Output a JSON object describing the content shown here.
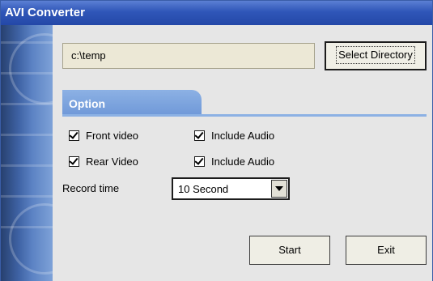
{
  "window": {
    "title": "AVI Converter"
  },
  "directory": {
    "value": "c:\\temp",
    "button_label": "Select Directory"
  },
  "option": {
    "tab_label": "Option",
    "front_video": {
      "label": "Front video",
      "checked": true
    },
    "front_audio": {
      "label": "Include Audio",
      "checked": true
    },
    "rear_video": {
      "label": "Rear Video",
      "checked": true
    },
    "rear_audio": {
      "label": "Include Audio",
      "checked": true
    }
  },
  "record_time": {
    "label": "Record time",
    "selected": "10 Second"
  },
  "buttons": {
    "start": "Start",
    "exit": "Exit"
  },
  "colors": {
    "title_bar": "#2f56b8",
    "tab": "#7aa2dc",
    "field_bg": "#ece8d6",
    "window_bg": "#e6e6e6"
  }
}
